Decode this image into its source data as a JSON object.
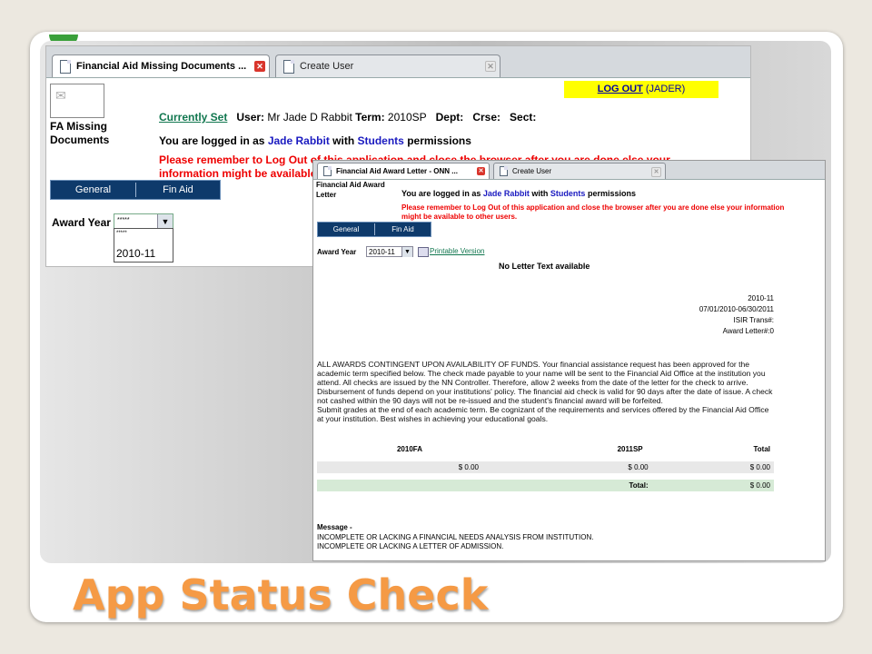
{
  "slide": {
    "title": "App Status Check"
  },
  "window_back": {
    "tabs": [
      {
        "label": "Financial Aid Missing Documents ...",
        "active": true
      },
      {
        "label": "Create User",
        "active": false
      }
    ],
    "logout": {
      "link": "LOG OUT",
      "user": "(JADER)"
    },
    "page_title": "FA Missing Documents",
    "currently_set": "Currently Set",
    "user_label": "User:",
    "user_value": "Mr Jade D Rabbit",
    "term_label": "Term:",
    "term_value": "2010SP",
    "dept_label": "Dept:",
    "crse_label": "Crse:",
    "sect_label": "Sect:",
    "logged_in_prefix": "You are logged in as",
    "logged_in_name": "Jade Rabbit",
    "logged_in_mid": "with",
    "logged_in_role": "Students",
    "logged_in_suffix": "permissions",
    "warning": "Please remember to Log Out of this application and close the browser after you are done else your information might be available",
    "nav": [
      "General",
      "Fin Aid"
    ],
    "award_year_label": "Award Year",
    "award_year_selected": "*****",
    "dropdown_options": [
      "*****",
      "2010-11"
    ]
  },
  "window_front": {
    "tabs": [
      {
        "label": "Financial Aid Award Letter - ONN ...",
        "active": true
      },
      {
        "label": "Create User",
        "active": false
      }
    ],
    "page_title": "Financial Aid Award Letter",
    "logged_in_prefix": "You are logged in as",
    "logged_in_name": "Jade Rabbit",
    "logged_in_mid": "with",
    "logged_in_role": "Students",
    "logged_in_suffix": "permissions",
    "warning": "Please remember to Log Out of this application and close the browser after you are done else your information might be available to other users.",
    "nav": [
      "General",
      "Fin Aid"
    ],
    "award_year_label": "Award Year",
    "award_year_value": "2010-11",
    "printable_link": "Printable Version",
    "no_letter": "No Letter Text available",
    "info": {
      "year": "2010-11",
      "dates": "07/01/2010-06/30/2011",
      "isir": "ISIR Trans#:",
      "award_letter": "Award Letter#:0"
    },
    "paragraph1": "ALL AWARDS CONTINGENT UPON AVAILABILITY OF FUNDS. Your financial assistance request has been approved for the academic term specified below. The check made payable to your name will be sent to the Financial Aid Office at the institution you attend. All checks are issued by the NN Controller. Therefore, allow 2 weeks from the date of the letter for the check to arrive. Disbursement of funds depend on your institutions' policy. The financial aid check is valid for 90 days after the date of issue. A check not cashed within the 90 days will not be re-issued and the student's financial award will be forfeited.",
    "paragraph2": "Submit grades at the end of each academic term. Be cognizant of the requirements and services offered by the Financial Aid Office at your institution. Best wishes in achieving your educational goals.",
    "table": {
      "headers": [
        "2010FA",
        "2011SP",
        "Total"
      ],
      "row": [
        "$ 0.00",
        "$ 0.00",
        "$ 0.00"
      ],
      "total_label": "Total:",
      "total_value": "$ 0.00"
    },
    "message_label": "Message -",
    "messages": [
      "INCOMPLETE OR LACKING A FINANCIAL NEEDS ANALYSIS FROM INSTITUTION.",
      "INCOMPLETE OR LACKING A LETTER OF ADMISSION."
    ]
  }
}
